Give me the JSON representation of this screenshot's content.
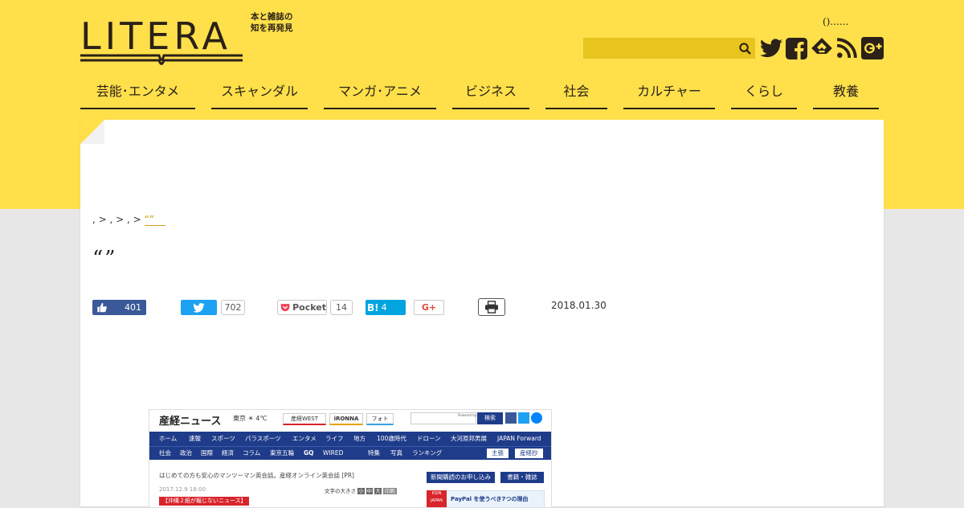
{
  "header": {
    "logo_text": "LITERA",
    "tagline_line1": "本と雑誌の",
    "tagline_line2": "知を再発見",
    "note": "()......",
    "search_placeholder": ""
  },
  "nav": [
    {
      "label": "芸能･エンタメ"
    },
    {
      "label": "スキャンダル"
    },
    {
      "label": "マンガ･アニメ"
    },
    {
      "label": "ビジネス"
    },
    {
      "label": "社会"
    },
    {
      "label": "カルチャー"
    },
    {
      "label": "くらし"
    },
    {
      "label": "教養"
    }
  ],
  "breadcrumb": {
    "part1": ", > , > , >",
    "current": "“”"
  },
  "article": {
    "title": "“”",
    "date": "2018.01.30"
  },
  "share": {
    "facebook_count": "401",
    "twitter_count": "702",
    "pocket_label": "Pocket",
    "pocket_count": "14",
    "hatena_label": "B!",
    "hatena_count": "4",
    "gplus_label": "G+"
  },
  "embedded_screenshot": {
    "logo": "産経ニュース",
    "weather": "東京 ☀ 4℃",
    "tabs": [
      "産経WEST",
      "iRONNA",
      "フォト"
    ],
    "search_button": "検索",
    "search_powered": "Powered by",
    "nav1": [
      "ホーム",
      "速報",
      "スポーツ",
      "パラスポーツ",
      "エンタメ",
      "ライフ",
      "地方",
      "100歳時代",
      "ドローン",
      "大河原邦男展",
      "JAPAN Forward"
    ],
    "nav2": [
      "社会",
      "政治",
      "国際",
      "経済",
      "コラム",
      "東京五輪",
      "GQ",
      "WIRED",
      "特集",
      "写真",
      "ランキング"
    ],
    "nav2_right": [
      "主張",
      "産経抄"
    ],
    "pr_text": "はじめての方も安心のマンツーマン英会話。産経オンライン英会話 [PR]",
    "button1": "新聞購読のお申し込み",
    "button2": "書籍・雑誌",
    "date": "2017.12.9 18:00",
    "text_size": "文字の大きさ",
    "size_options": [
      "小",
      "中",
      "大"
    ],
    "print_label": "印刷",
    "red_label": "【沖縄２紙が報じないニュース】",
    "ad_brand": "KSIN JAPAN",
    "ad_text": "PayPal を使うべき7つの理由"
  },
  "colors": {
    "brand_yellow": "#ffe04b",
    "dark": "#2b2118",
    "facebook": "#3b5998",
    "twitter": "#1da1f2",
    "hatena": "#00a4de"
  }
}
